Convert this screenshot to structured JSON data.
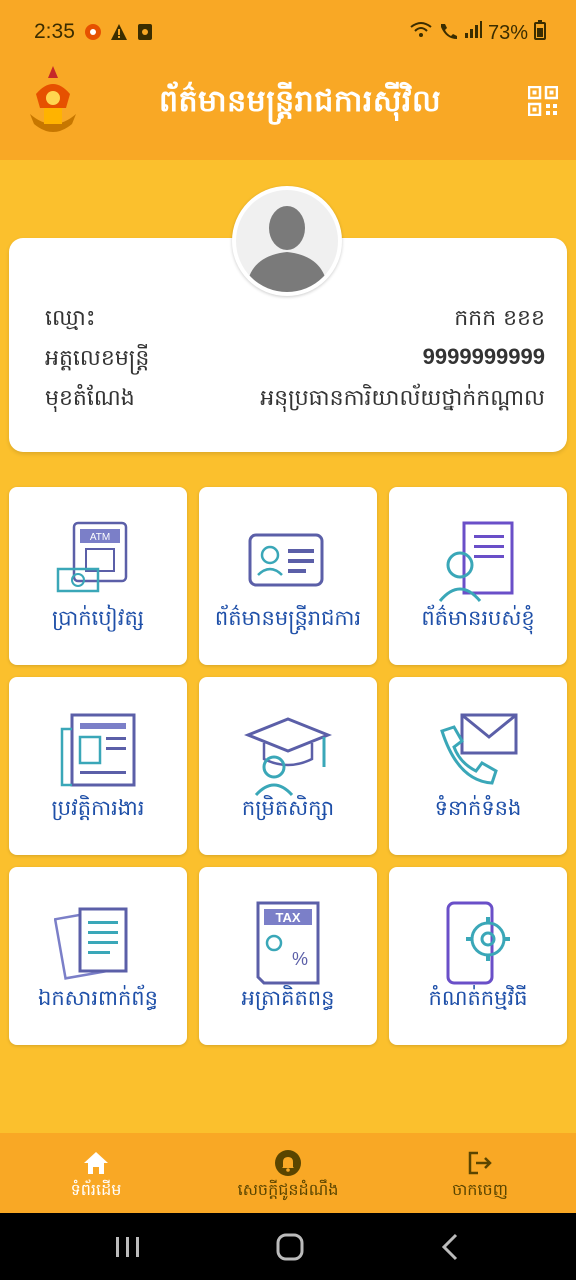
{
  "status_bar": {
    "time": "2:35",
    "battery": "73%"
  },
  "app_bar": {
    "title": "ព័ត៌មានមន្ត្រីរាជការស៊ីវិល",
    "logo_icon": "royal-emblem-icon",
    "qr_icon": "qr-code-icon"
  },
  "profile": {
    "name_label": "ឈ្មោះ",
    "name_value": "កកក ខខខ",
    "id_label": "អត្តលេខមន្ត្រី",
    "id_value": "9999999999",
    "position_label": "មុខតំណែង",
    "position_value": "អនុប្រធានការិយាល័យថ្នាក់កណ្តាល"
  },
  "menu": [
    {
      "label": "ប្រាក់បៀវត្ស",
      "icon": "atm-icon"
    },
    {
      "label": "ព័ត៌មានមន្ត្រីរាជការ",
      "icon": "id-card-icon"
    },
    {
      "label": "ព័ត៌មានរបស់ខ្ញុំ",
      "icon": "user-document-icon"
    },
    {
      "label": "ប្រវត្តិការងារ",
      "icon": "newspaper-icon"
    },
    {
      "label": "កម្រិតសិក្សា",
      "icon": "graduation-icon"
    },
    {
      "label": "ទំនាក់ទំនង",
      "icon": "contact-mail-phone-icon"
    },
    {
      "label": "ឯកសារពាក់ព័ន្ធ",
      "icon": "documents-icon"
    },
    {
      "label": "អត្រាគិតពន្ធ",
      "icon": "tax-icon"
    },
    {
      "label": "កំណត់កម្មវិធី",
      "icon": "app-settings-icon"
    }
  ],
  "bottom_nav": {
    "home_label": "ទំព័រដើម",
    "notifications_label": "សេចក្តីជូនដំណឹង",
    "logout_label": "ចាកចេញ"
  },
  "colors": {
    "primary": "#f9a825",
    "background": "#fbc02d",
    "label_blue": "#1e4fa8"
  }
}
